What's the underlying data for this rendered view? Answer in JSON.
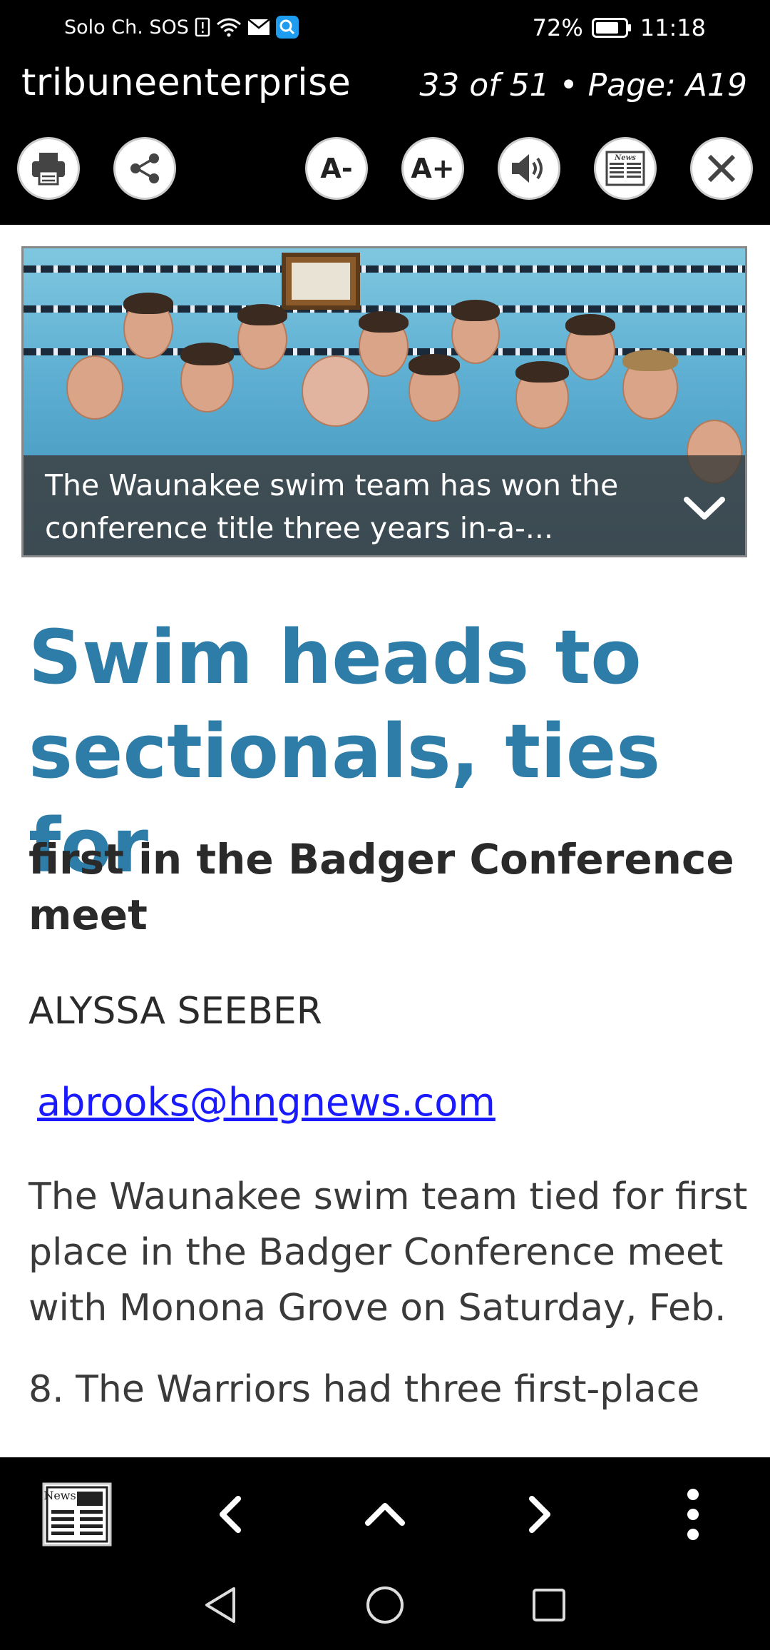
{
  "status_bar": {
    "carrier": "Solo Ch. SOS",
    "battery": "72%",
    "time": "11:18"
  },
  "header": {
    "app_title": "tribuneenterprise",
    "page_info": "33 of 51 • Page: A19"
  },
  "toolbar": {
    "font_decrease_label": "A-",
    "font_increase_label": "A+",
    "news_label": "News",
    "icons": [
      "print-icon",
      "share-icon",
      "font-decrease",
      "font-increase",
      "speaker-icon",
      "news-icon",
      "close-icon"
    ]
  },
  "article": {
    "image_caption": "The Waunakee swim team has won the conference title three years in-a-...",
    "headline": "Swim heads to sectionals, ties for",
    "subheadline": "first in the Badger Conference meet",
    "author": "ALYSSA SEEBER",
    "email": "abrooks@hngnews.com",
    "body": "The Waunakee swim team tied for first place in the Badger Conference meet with Monona Grove on Saturday, Feb.",
    "body_cutoff": "8. The Warriors had three first-place"
  },
  "bottom_nav": {
    "news_label": "News",
    "icons": [
      "news-icon",
      "chevron-left-icon",
      "chevron-up-icon",
      "chevron-right-icon",
      "more-vertical-icon"
    ]
  },
  "colors": {
    "headline": "#2d7da8",
    "link": "#1a1aff",
    "toolbar_bg": "#000000"
  }
}
